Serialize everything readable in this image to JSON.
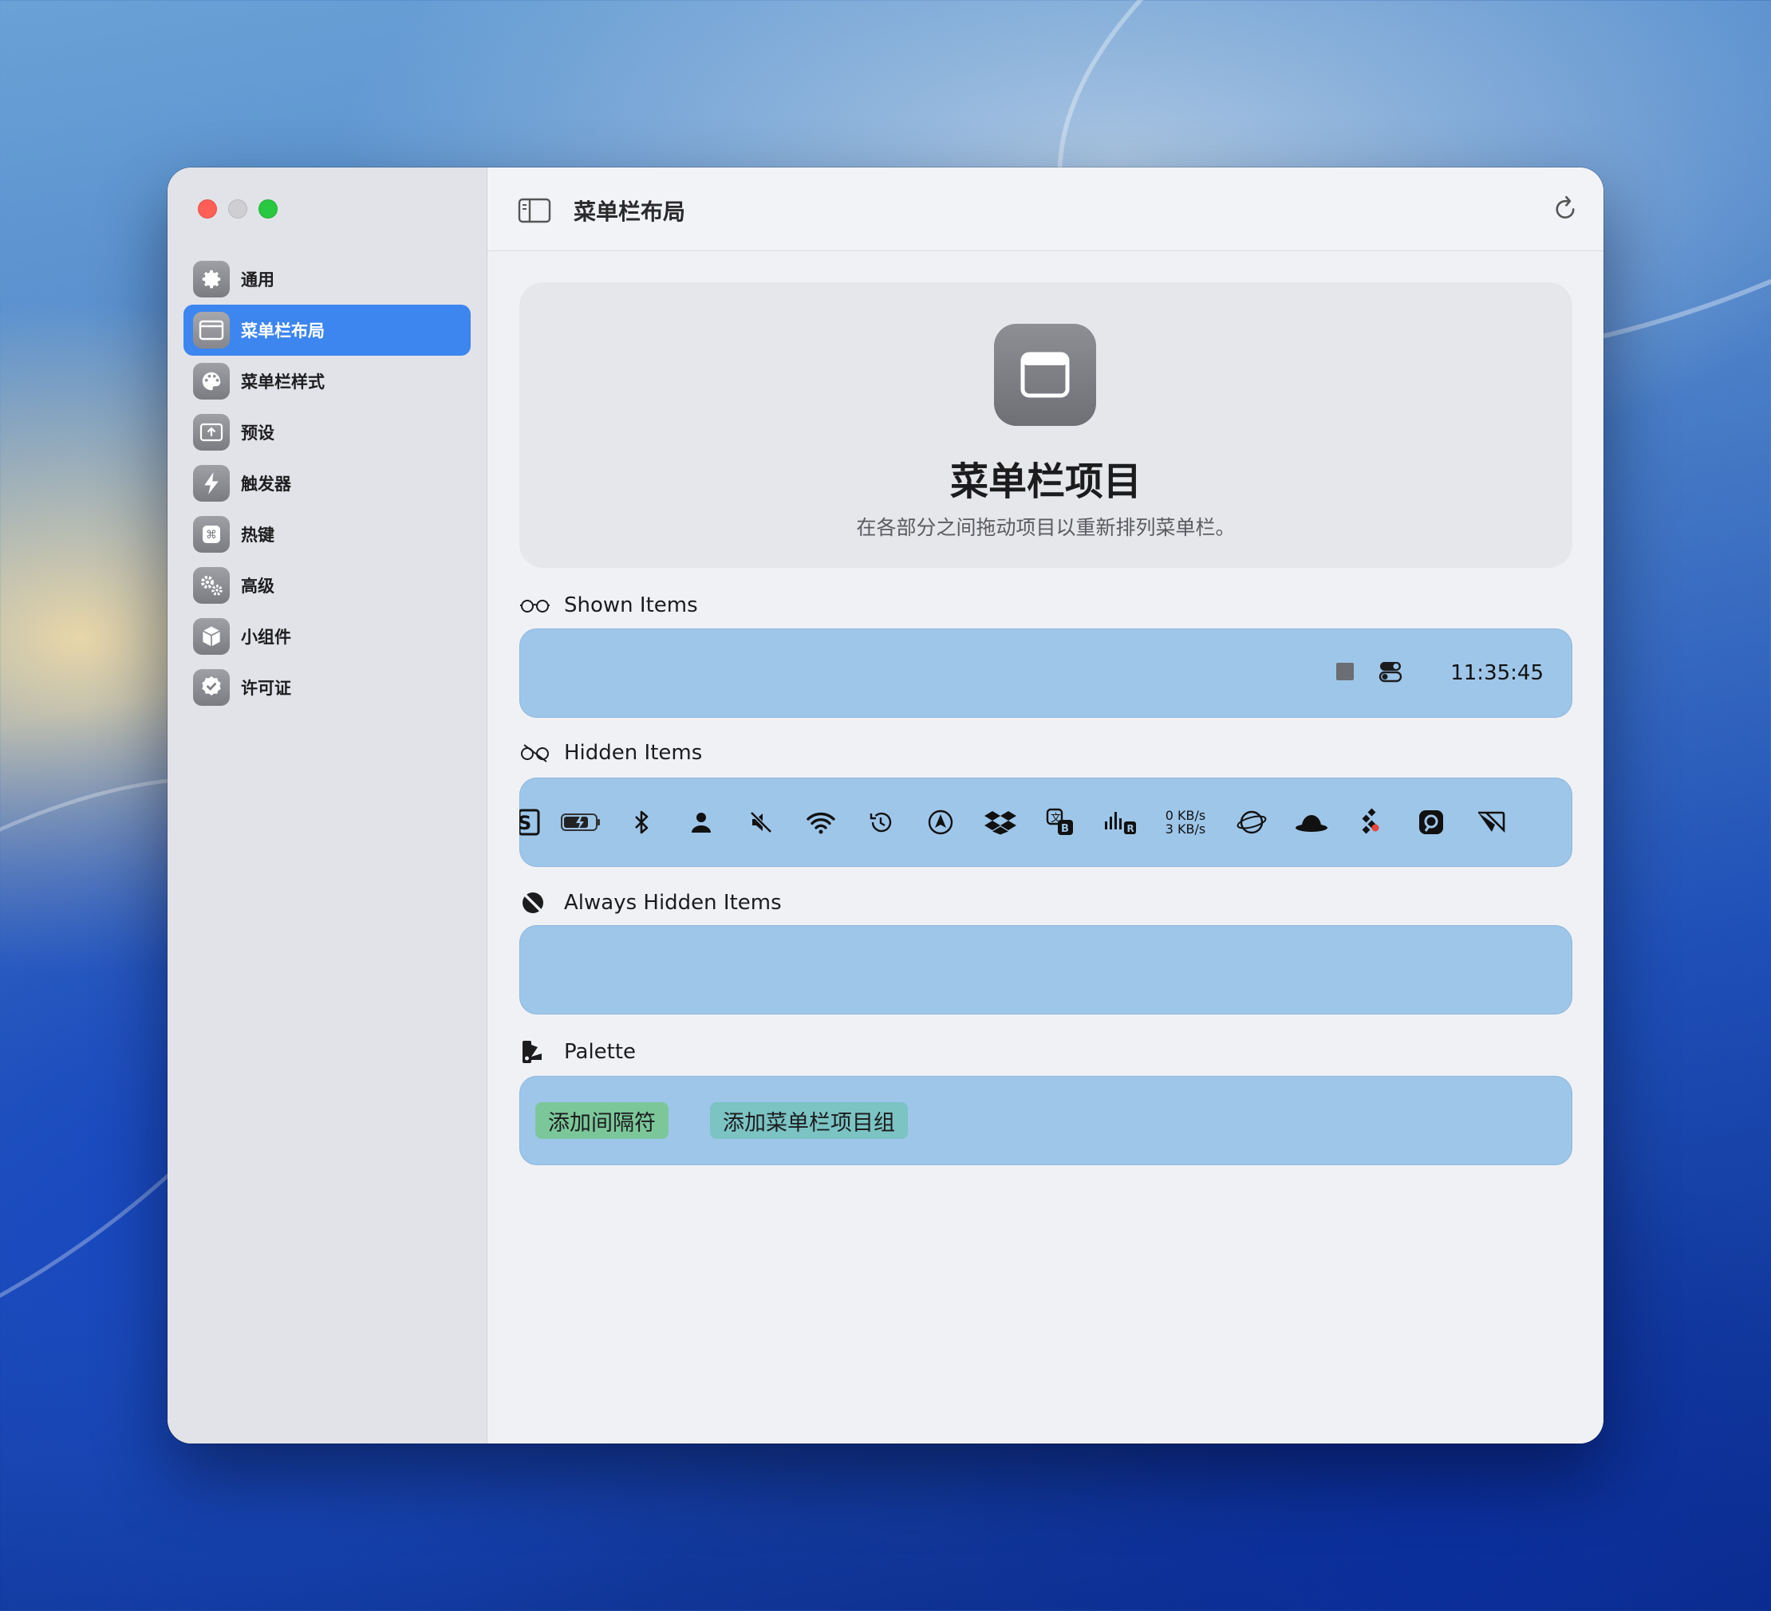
{
  "window": {
    "title": "菜单栏布局"
  },
  "sidebar": {
    "items": [
      {
        "label": "通用",
        "icon": "gear-icon",
        "active": false
      },
      {
        "label": "菜单栏布局",
        "icon": "menubar-layout-icon",
        "active": true
      },
      {
        "label": "菜单栏样式",
        "icon": "palette-icon",
        "active": false
      },
      {
        "label": "预设",
        "icon": "preset-icon",
        "active": false
      },
      {
        "label": "触发器",
        "icon": "bolt-icon",
        "active": false
      },
      {
        "label": "热键",
        "icon": "command-key-icon",
        "active": false
      },
      {
        "label": "高级",
        "icon": "gears-icon",
        "active": false
      },
      {
        "label": "小组件",
        "icon": "cube-icon",
        "active": false
      },
      {
        "label": "许可证",
        "icon": "checkmark-seal-icon",
        "active": false
      }
    ]
  },
  "hero": {
    "title": "菜单栏项目",
    "subtitle": "在各部分之间拖动项目以重新排列菜单栏。"
  },
  "sections": {
    "shown": {
      "label": "Shown Items",
      "clock": "11:35:45"
    },
    "hidden": {
      "label": "Hidden Items",
      "net_down": "0 KB/s",
      "net_up": "3 KB/s"
    },
    "always_hidden": {
      "label": "Always Hidden Items"
    },
    "palette": {
      "label": "Palette",
      "add_spacer": "添加间隔符",
      "add_group": "添加菜单栏项目组"
    }
  },
  "colors": {
    "accent": "#3d86f0",
    "section_bar": "#9ec6e9",
    "spacer_button": "#7cc79a",
    "group_button": "#7cc3c4"
  }
}
